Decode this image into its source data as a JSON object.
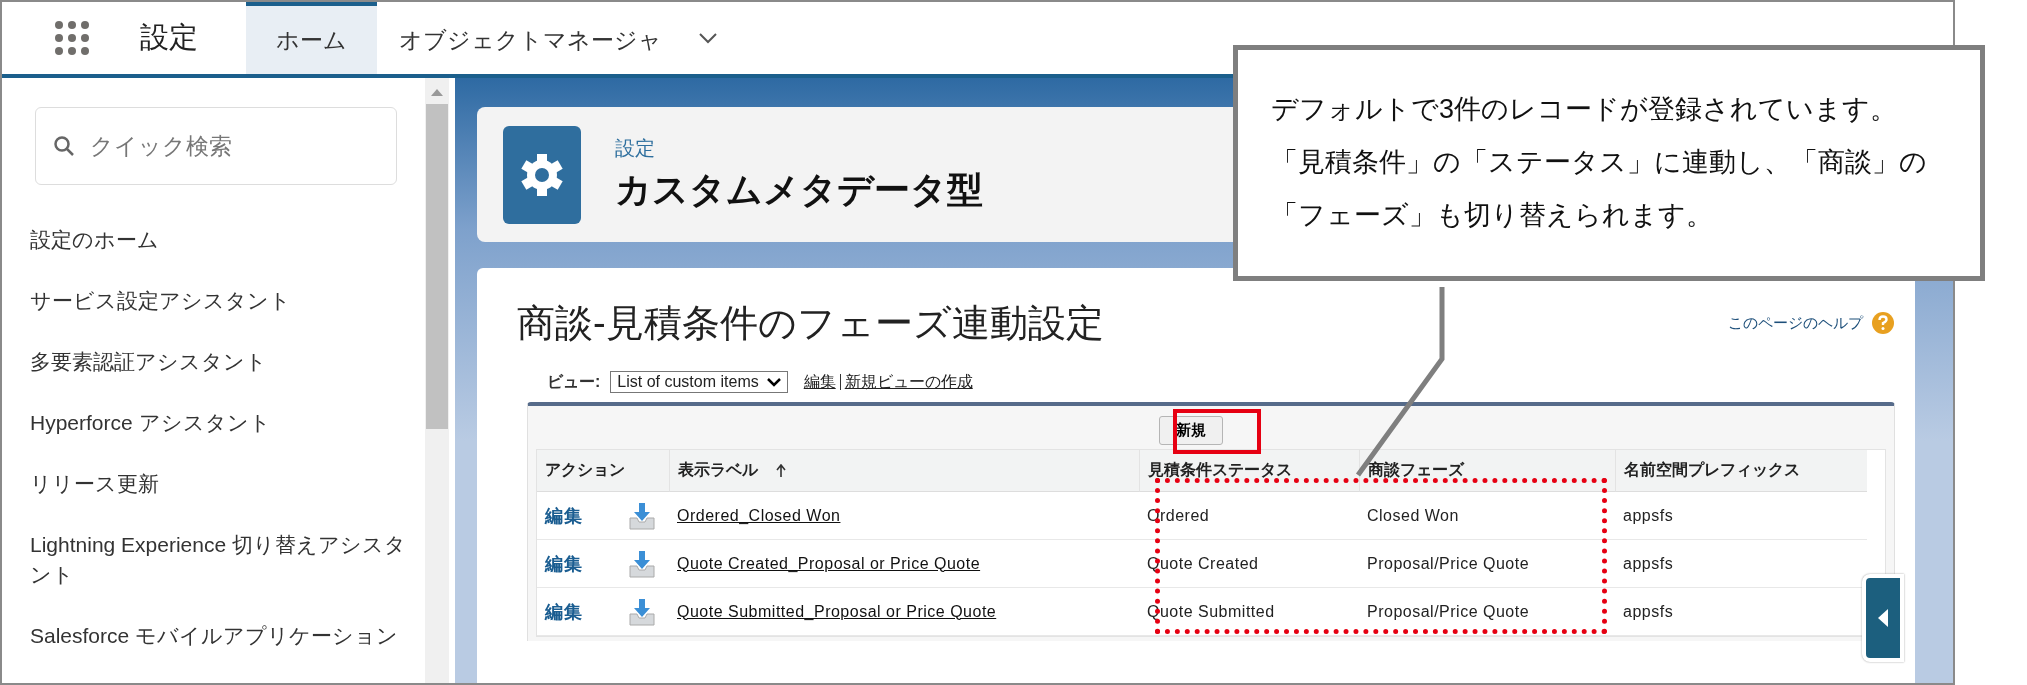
{
  "app_bar": {
    "title": "設定",
    "tabs": [
      {
        "label": "ホーム",
        "selected": true
      },
      {
        "label": "オブジェクトマネージャ",
        "selected": false
      }
    ]
  },
  "sidebar": {
    "search": {
      "placeholder": "クイック検索"
    },
    "items": [
      "設定のホーム",
      "サービス設定アシスタント",
      "多要素認証アシスタント",
      "Hyperforce アシスタント",
      "リリース更新",
      "Lightning Experience 切り替えアシスタント",
      "Salesforce モバイルアプリケーション"
    ]
  },
  "header": {
    "breadcrumb": "設定",
    "title": "カスタムメタデータ型"
  },
  "page": {
    "title": "商談-見積条件のフェーズ連動設定",
    "help_link": "このページのヘルプ",
    "view": {
      "label": "ビュー:",
      "value": "List of custom items",
      "links": [
        "編集",
        "新規ビューの作成"
      ]
    },
    "new_button": "新規",
    "table": {
      "columns": [
        "アクション",
        "表示ラベル",
        "見積条件ステータス",
        "商談フェーズ",
        "名前空間プレフィックス"
      ],
      "rows": [
        {
          "action": "編集",
          "label": "Ordered_Closed Won",
          "status": "Ordered",
          "phase": "Closed Won",
          "namespace": "appsfs"
        },
        {
          "action": "編集",
          "label": "Quote Created_Proposal or Price Quote",
          "status": "Quote Created",
          "phase": "Proposal/Price Quote",
          "namespace": "appsfs"
        },
        {
          "action": "編集",
          "label": "Quote Submitted_Proposal or Price Quote",
          "status": "Quote Submitted",
          "phase": "Proposal/Price Quote",
          "namespace": "appsfs"
        }
      ]
    }
  },
  "callout": {
    "lines": [
      "デフォルトで3件のレコードが登録されています。",
      "「見積条件」の「ステータス」に連動し、「商談」の",
      "「フェーズ」も切り替えられます。"
    ]
  }
}
